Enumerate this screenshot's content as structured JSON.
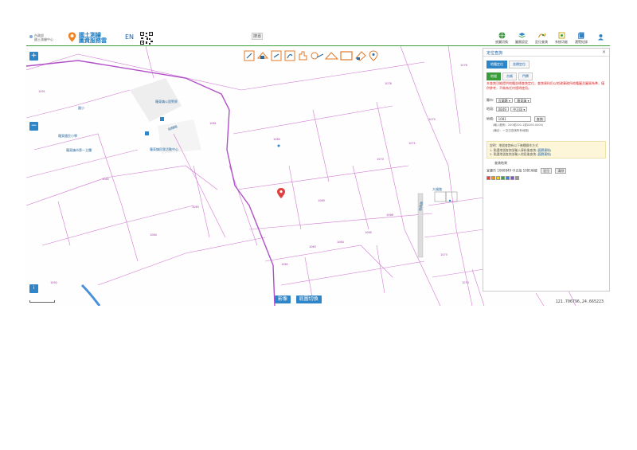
{
  "header": {
    "org_line1": "內政部",
    "org_line2": "國土測繪中心",
    "logo_line1": "國土測繪",
    "logo_line2": "圖資服務雲",
    "en_label": "EN",
    "search_label": "搜尋",
    "tools": [
      {
        "label": "底圖切換",
        "icon": "globe-icon",
        "color": "#3a9d3a"
      },
      {
        "label": "圖層設定",
        "icon": "layers-icon",
        "color": "#2e86c8"
      },
      {
        "label": "定位查詢",
        "icon": "locate-icon",
        "color": "#d48a1a"
      },
      {
        "label": "系統功能",
        "icon": "system-icon",
        "color": "#c8a81a"
      },
      {
        "label": "瀏覽紀錄",
        "icon": "history-icon",
        "color": "#2e86c8"
      }
    ]
  },
  "map": {
    "zoom_in": "+",
    "zoom_out": "−",
    "info": "i",
    "scale_label": "",
    "labels": {
      "school": "羅東國民小學",
      "school2": "國小",
      "police": "羅東鎮公園警察",
      "building": "羅東鎮民眾活動中心",
      "road": "純精路",
      "station": "羅東鎮市第一立體",
      "road2": "復興路",
      "road3": "大福路"
    },
    "parcels": [
      "1061",
      "1063",
      "1064",
      "1065",
      "1066",
      "1069",
      "1070",
      "1071",
      "1073",
      "1074",
      "1075",
      "1076",
      "1078",
      "1080",
      "1081",
      "1083",
      "1084",
      "1085",
      "1091",
      "1092",
      "1093",
      "1094"
    ],
    "btn_image": "影像",
    "btn_basemap": "底圖切換",
    "coordinate": "121.706796,24.665223"
  },
  "panel": {
    "title": "定位查詢",
    "close": "×",
    "tabs_top": [
      "地籍定位",
      "坐標定位"
    ],
    "tabs_second": [
      "地號",
      "台帳",
      "門牌"
    ],
    "notice": "本查詢功能提供地籍坐標查詢定位，查詢資料仍以地政事務所地籍圖及圖資為準，僅供參考，不做為任何證明使用。",
    "county_label": "縣市:",
    "county_value": "宜蘭縣",
    "town_value": "羅東鎮",
    "section_label": "地段:",
    "section_value": "0849",
    "section_name": "中正段",
    "lot_label": "地號:",
    "lot_value": "1081",
    "search_btn": "查詢",
    "hint1": "(輸入範例：200或200-1或0200-0000)",
    "hint2": "(備註：→ 空白查詢所有地號)",
    "tip_line1": "說明：地號查詢有以下幾種操作方式",
    "tip_line2": "1. 點選地號查詢並輸入資料後查詢",
    "tip_line2_link": "(圖層連結)",
    "tip_line3": "2. 點選地號查詢並輸入地段後查詢",
    "tip_line3_link": "(圖層連結)",
    "count_text": "查詢結果",
    "result_text": "宜蘭市 1060849 中正段 1081地號",
    "btn_locate": "定位",
    "btn_clear": "清除",
    "swatch_colors": [
      "#e04040",
      "#f09020",
      "#f0d020",
      "#40a040",
      "#4080d0",
      "#8050c0",
      "#999999"
    ]
  }
}
